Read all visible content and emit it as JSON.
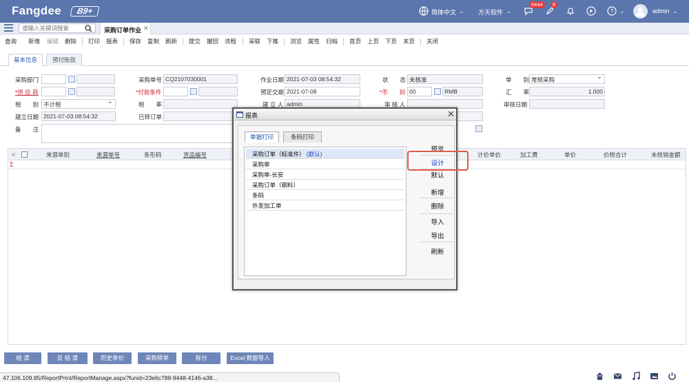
{
  "topbar": {
    "logo": "Fangdee",
    "logo_badge": "B9+",
    "language": "简体中文",
    "company": "方天软件",
    "msg_count": "6444",
    "task_count": "8",
    "user": "admin"
  },
  "tabbar": {
    "search_placeholder": "请输入关键词搜索",
    "active_tab": "采购订单作业"
  },
  "toolbar": [
    "查询",
    "新增",
    "编辑",
    "删除",
    "打印",
    "报表",
    "保存",
    "复制",
    "刷新",
    "提交",
    "撤回",
    "流程",
    "采联",
    "下推",
    "浏览",
    "属性",
    "归档",
    "首页",
    "上页",
    "下页",
    "末页",
    "关闭"
  ],
  "form_tabs": [
    "基本信息",
    "预付账款"
  ],
  "form": {
    "purchase_dept": "采购部门",
    "supplier": "*供 应 商",
    "tax_type_label": "税　　别",
    "tax_type_value": "不计税",
    "created_date_label": "建立日期",
    "created_date_value": "2021-07-03 08:54:32",
    "remark": "备　　注",
    "order_no_label": "采购单号",
    "order_no_value": "CQ2107030001",
    "pay_terms": "*付款条件",
    "tax_rate": "税　　率",
    "transferred": "已转订单",
    "work_date_label": "作业日期",
    "work_date_value": "2021-07-03 08:54:32",
    "delivery_label": "预定交期",
    "delivery_value": "2021-07-08",
    "creator_label": "建 立 人",
    "creator_value": "admin",
    "status_label": "状　　态",
    "status_value": "未核准",
    "currency_label": "*币　　别",
    "currency_code": "00",
    "currency_name": "RMB",
    "approver_label": "审 核 人",
    "doc_type_label": "单　　别",
    "doc_type_value": "常规采购",
    "rate_label": "汇　　率",
    "rate_value": "1.000",
    "approve_date_label": "审核日期"
  },
  "grid": {
    "columns_left": [
      "来源单别",
      "来源单号",
      "条形码",
      "货品编号"
    ],
    "columns_right": [
      "计价单价",
      "加工费",
      "单价",
      "价税合计",
      "未核销金额"
    ],
    "sum_symbol": "Σ"
  },
  "bottom_buttons": [
    "结 清",
    "反 结 清",
    "历史单价",
    "采购转单",
    "拆分",
    "Excel 数据导入"
  ],
  "status_url": "47.106.109.85/ReportPrint/ReportManage.aspx?funid=23e6c788-9448-4146-a38...",
  "dialog": {
    "title": "报表",
    "close": "✕",
    "tabs": [
      "单据打印",
      "条码打印"
    ],
    "reports": [
      {
        "name": "采购订单（标准件）",
        "suffix": "(默认)"
      },
      {
        "name": "采购单",
        "suffix": ""
      },
      {
        "name": "采购单-长安",
        "suffix": ""
      },
      {
        "name": "采购订单（钢料）",
        "suffix": ""
      },
      {
        "name": "条码",
        "suffix": ""
      },
      {
        "name": "外发加工单",
        "suffix": ""
      }
    ],
    "buttons": [
      "预览",
      "设计",
      "默认",
      "新增",
      "删除",
      "导入",
      "导出",
      "刷新"
    ]
  },
  "colors": {
    "topbar": "#5b75ad",
    "highlight": "#e0584a",
    "button": "#6f87b8"
  }
}
